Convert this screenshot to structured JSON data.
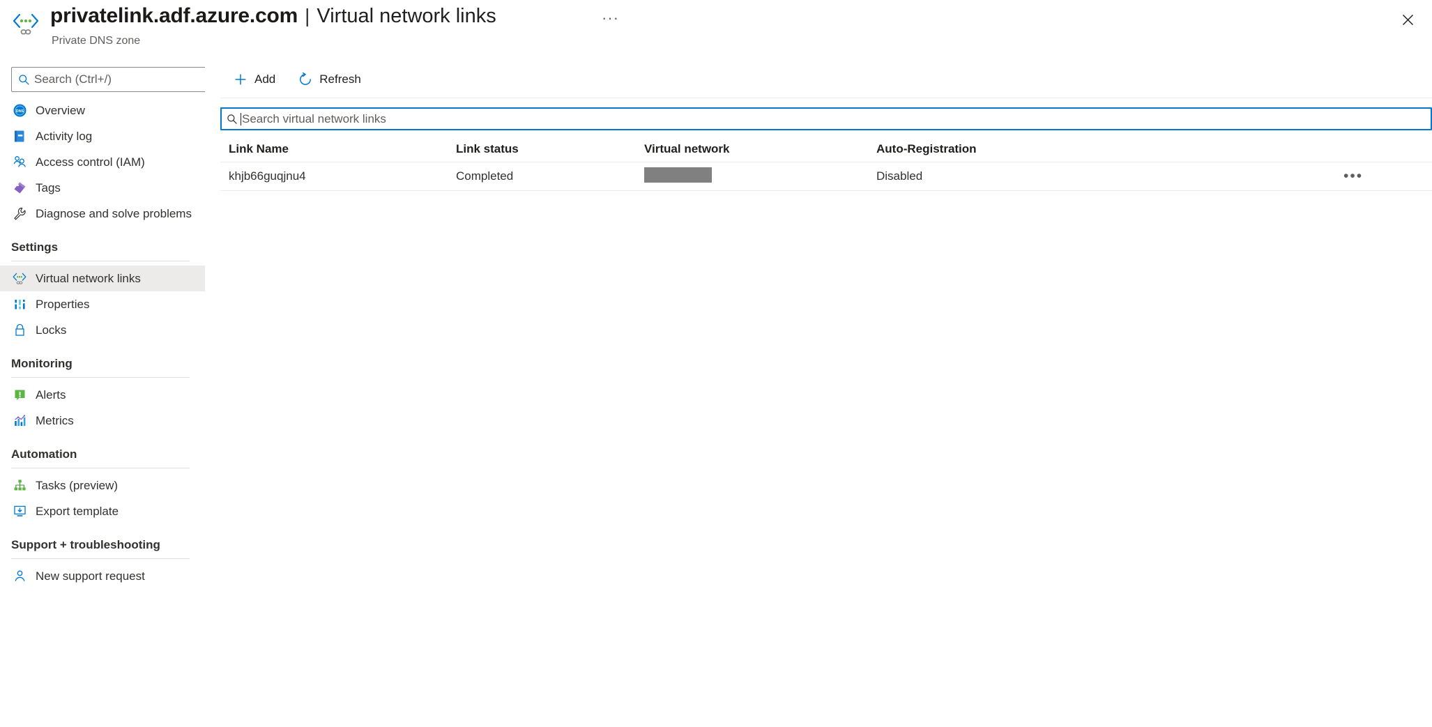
{
  "header": {
    "resource_name": "privatelink.adf.azure.com",
    "separator": "|",
    "page_name": "Virtual network links",
    "more_ellipsis": "···",
    "subtitle": "Private DNS zone",
    "resource_icon": "private-dns-zone-icon",
    "close_icon": "close-icon"
  },
  "sidebar": {
    "search": {
      "placeholder": "Search (Ctrl+/)",
      "icon": "search-icon"
    },
    "collapse": {
      "icon": "double-chevron-left-icon",
      "glyph": "«"
    },
    "items": [
      {
        "label": "Overview",
        "icon": "dns-overview-icon",
        "selected": false
      },
      {
        "label": "Activity log",
        "icon": "activity-log-icon",
        "selected": false
      },
      {
        "label": "Access control (IAM)",
        "icon": "access-control-users-icon",
        "selected": false
      },
      {
        "label": "Tags",
        "icon": "tags-icon",
        "selected": false
      },
      {
        "label": "Diagnose and solve problems",
        "icon": "wrench-icon",
        "selected": false
      }
    ],
    "sections": [
      {
        "title": "Settings",
        "items": [
          {
            "label": "Virtual network links",
            "icon": "virtual-network-link-icon",
            "selected": true
          },
          {
            "label": "Properties",
            "icon": "properties-bars-icon",
            "selected": false
          },
          {
            "label": "Locks",
            "icon": "lock-icon",
            "selected": false
          }
        ]
      },
      {
        "title": "Monitoring",
        "items": [
          {
            "label": "Alerts",
            "icon": "alerts-icon",
            "selected": false
          },
          {
            "label": "Metrics",
            "icon": "metrics-chart-icon",
            "selected": false
          }
        ]
      },
      {
        "title": "Automation",
        "items": [
          {
            "label": "Tasks (preview)",
            "icon": "tasks-hierarchy-icon",
            "selected": false
          },
          {
            "label": "Export template",
            "icon": "export-template-icon",
            "selected": false
          }
        ]
      },
      {
        "title": "Support + troubleshooting",
        "items": [
          {
            "label": "New support request",
            "icon": "support-person-icon",
            "selected": false
          }
        ]
      }
    ]
  },
  "toolbar": {
    "add_label": "Add",
    "add_icon": "plus-icon",
    "refresh_label": "Refresh",
    "refresh_icon": "refresh-icon"
  },
  "filter": {
    "placeholder": "Search virtual network links",
    "value": "",
    "icon": "search-icon"
  },
  "table": {
    "columns": [
      "Link Name",
      "Link status",
      "Virtual network",
      "Auto-Registration"
    ],
    "rows": [
      {
        "link_name": "khjb66guqjnu4",
        "link_status": "Completed",
        "virtual_network": "",
        "virtual_network_redacted": true,
        "auto_registration": "Disabled",
        "context_menu_glyph": "•••"
      }
    ]
  },
  "colors": {
    "accent": "#0078d4",
    "selected_row_bg": "#edebe9",
    "redaction": "#808080",
    "text_primary": "#323130",
    "text_secondary": "#605e5c"
  }
}
